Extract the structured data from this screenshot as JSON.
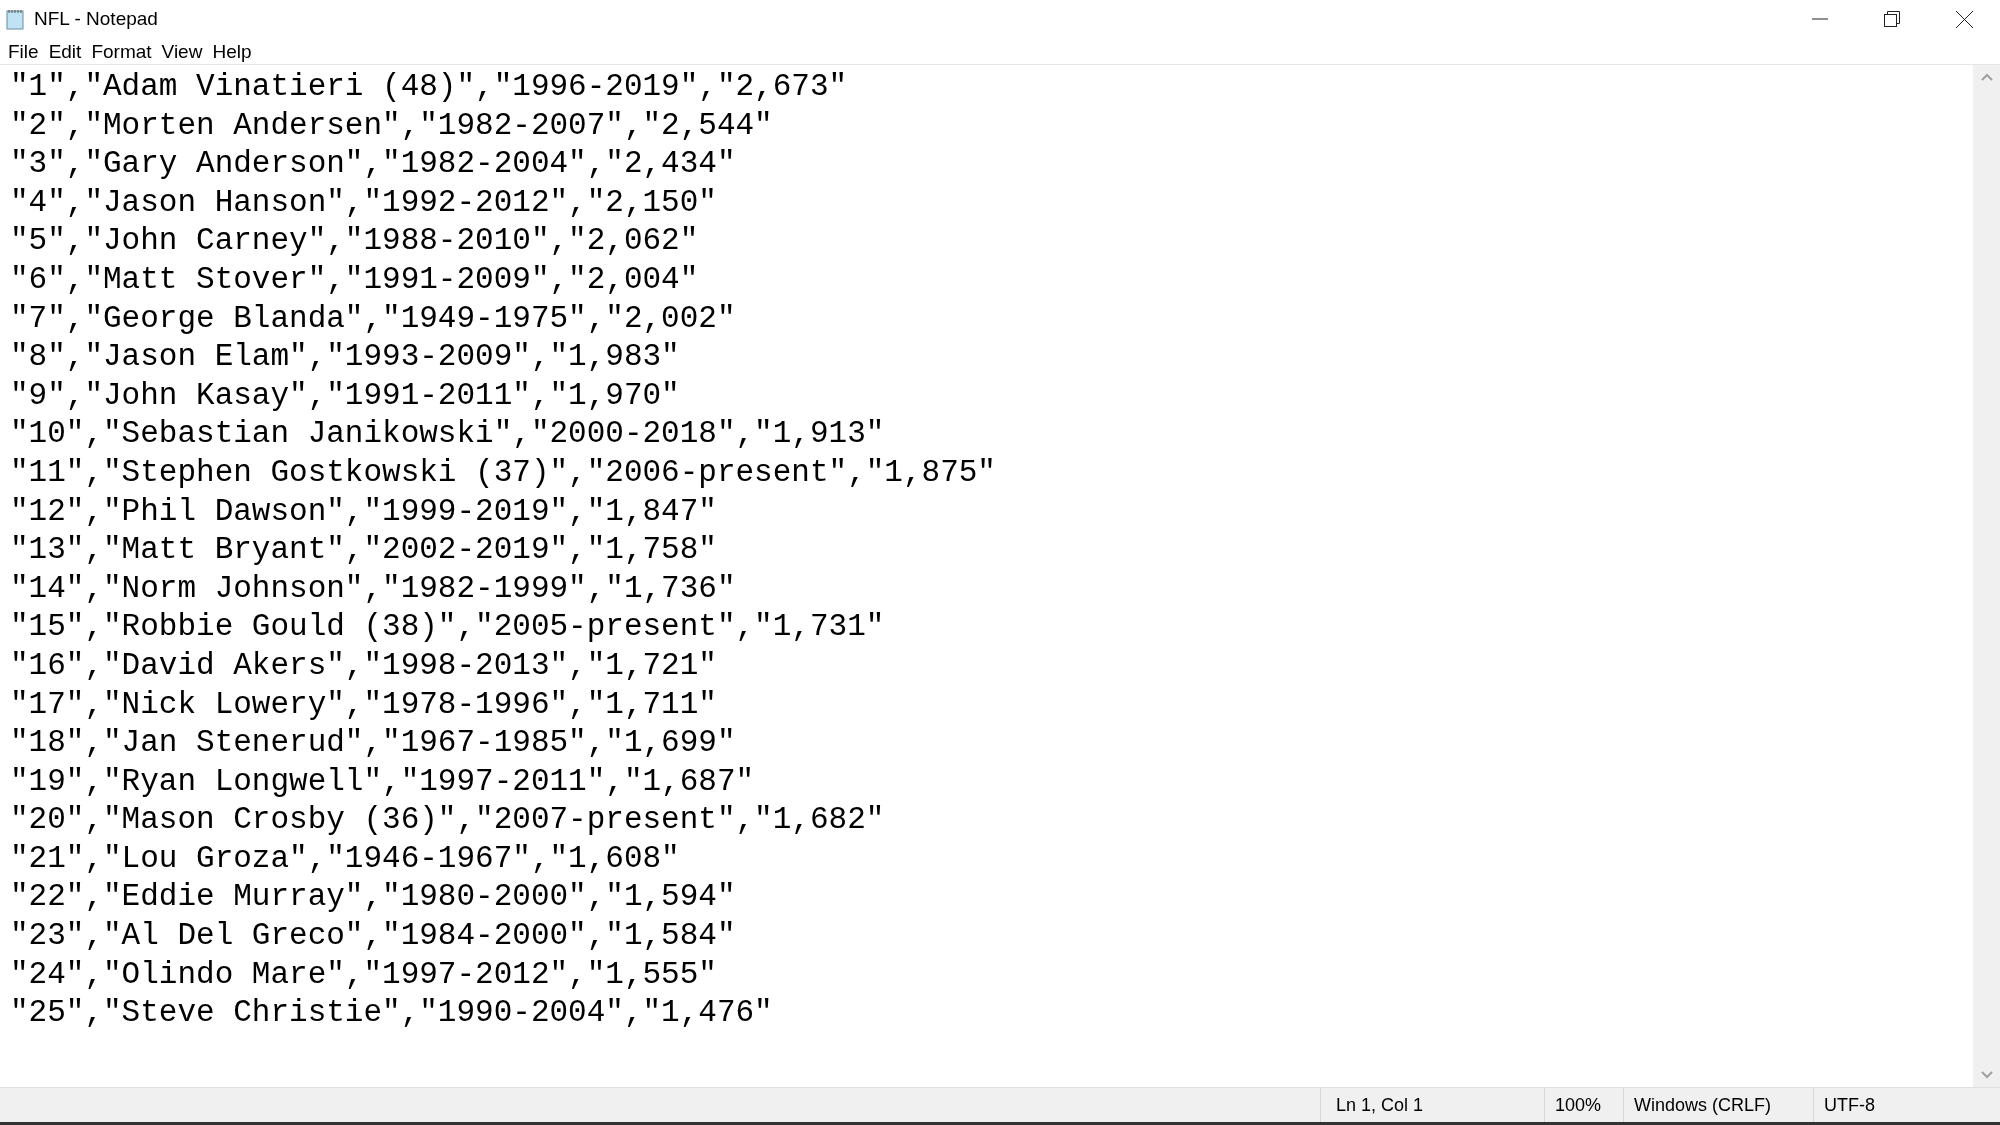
{
  "window": {
    "title": "NFL - Notepad"
  },
  "menu": [
    "File",
    "Edit",
    "Format",
    "View",
    "Help"
  ],
  "lines": [
    "\"1\",\"Adam Vinatieri (48)\",\"1996-2019\",\"2,673\"",
    "\"2\",\"Morten Andersen\",\"1982-2007\",\"2,544\"",
    "\"3\",\"Gary Anderson\",\"1982-2004\",\"2,434\"",
    "\"4\",\"Jason Hanson\",\"1992-2012\",\"2,150\"",
    "\"5\",\"John Carney\",\"1988-2010\",\"2,062\"",
    "\"6\",\"Matt Stover\",\"1991-2009\",\"2,004\"",
    "\"7\",\"George Blanda\",\"1949-1975\",\"2,002\"",
    "\"8\",\"Jason Elam\",\"1993-2009\",\"1,983\"",
    "\"9\",\"John Kasay\",\"1991-2011\",\"1,970\"",
    "\"10\",\"Sebastian Janikowski\",\"2000-2018\",\"1,913\"",
    "\"11\",\"Stephen Gostkowski (37)\",\"2006-present\",\"1,875\"",
    "\"12\",\"Phil Dawson\",\"1999-2019\",\"1,847\"",
    "\"13\",\"Matt Bryant\",\"2002-2019\",\"1,758\"",
    "\"14\",\"Norm Johnson\",\"1982-1999\",\"1,736\"",
    "\"15\",\"Robbie Gould (38)\",\"2005-present\",\"1,731\"",
    "\"16\",\"David Akers\",\"1998-2013\",\"1,721\"",
    "\"17\",\"Nick Lowery\",\"1978-1996\",\"1,711\"",
    "\"18\",\"Jan Stenerud\",\"1967-1985\",\"1,699\"",
    "\"19\",\"Ryan Longwell\",\"1997-2011\",\"1,687\"",
    "\"20\",\"Mason Crosby (36)\",\"2007-present\",\"1,682\"",
    "\"21\",\"Lou Groza\",\"1946-1967\",\"1,608\"",
    "\"22\",\"Eddie Murray\",\"1980-2000\",\"1,594\"",
    "\"23\",\"Al Del Greco\",\"1984-2000\",\"1,584\"",
    "\"24\",\"Olindo Mare\",\"1997-2012\",\"1,555\"",
    "\"25\",\"Steve Christie\",\"1990-2004\",\"1,476\""
  ],
  "status_bar": {
    "position": "Ln 1, Col 1",
    "zoom": "100%",
    "line_ending": "Windows (CRLF)",
    "encoding": "UTF-8"
  }
}
